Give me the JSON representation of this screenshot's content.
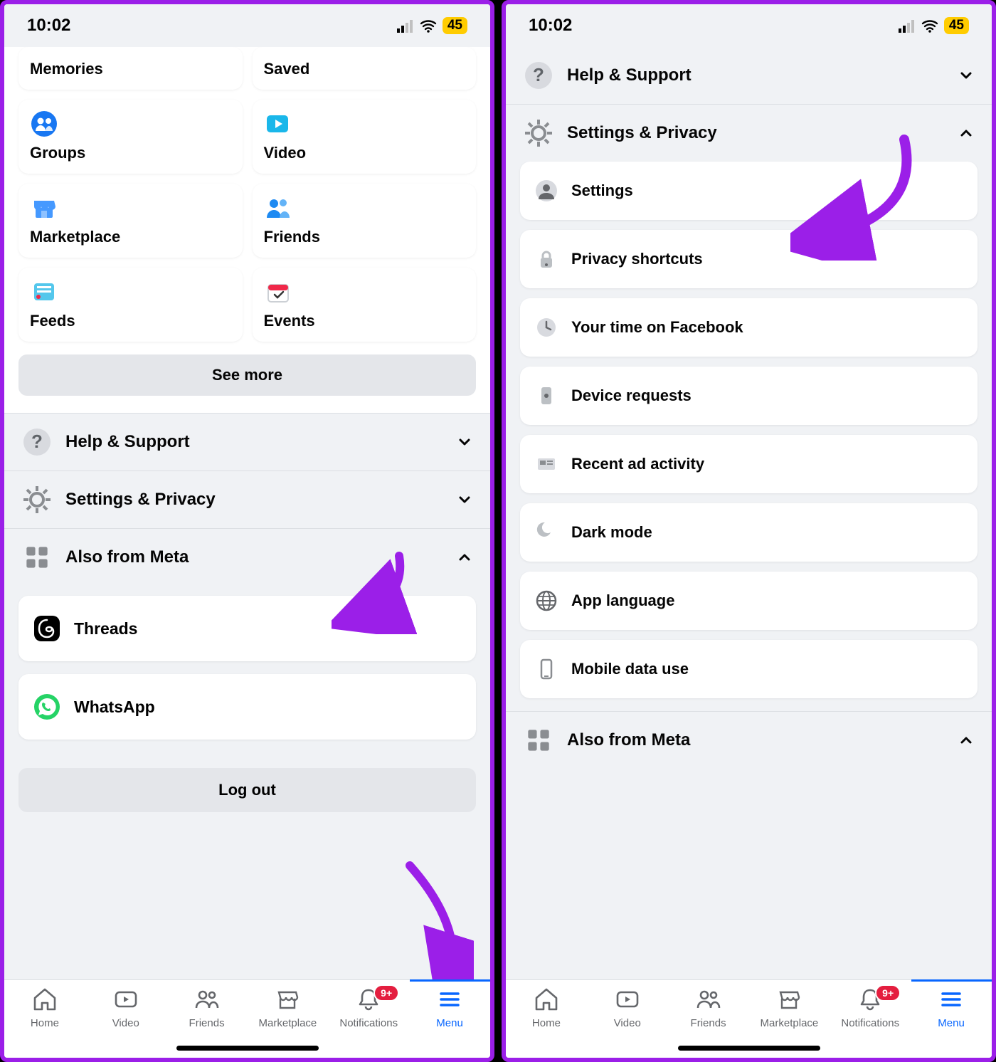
{
  "status": {
    "time": "10:02",
    "battery": "45"
  },
  "left": {
    "shortcuts": [
      {
        "id": "memories",
        "label": "Memories"
      },
      {
        "id": "saved",
        "label": "Saved"
      },
      {
        "id": "groups",
        "label": "Groups"
      },
      {
        "id": "video",
        "label": "Video"
      },
      {
        "id": "marketplace",
        "label": "Marketplace"
      },
      {
        "id": "friends",
        "label": "Friends"
      },
      {
        "id": "feeds",
        "label": "Feeds"
      },
      {
        "id": "events",
        "label": "Events"
      }
    ],
    "see_more": "See more",
    "sections": {
      "help": "Help & Support",
      "settings": "Settings & Privacy",
      "meta": "Also from Meta"
    },
    "meta_items": [
      {
        "id": "threads",
        "label": "Threads"
      },
      {
        "id": "whatsapp",
        "label": "WhatsApp"
      }
    ],
    "logout": "Log out"
  },
  "right": {
    "sections": {
      "help": "Help & Support",
      "settings": "Settings & Privacy",
      "meta": "Also from Meta"
    },
    "settings_items": [
      {
        "id": "settings",
        "label": "Settings"
      },
      {
        "id": "privacy-shortcuts",
        "label": "Privacy shortcuts"
      },
      {
        "id": "your-time",
        "label": "Your time on Facebook"
      },
      {
        "id": "device-requests",
        "label": "Device requests"
      },
      {
        "id": "recent-ad",
        "label": "Recent ad activity"
      },
      {
        "id": "dark-mode",
        "label": "Dark mode"
      },
      {
        "id": "app-language",
        "label": "App language"
      },
      {
        "id": "mobile-data",
        "label": "Mobile data use"
      }
    ]
  },
  "tabs": [
    {
      "id": "home",
      "label": "Home"
    },
    {
      "id": "video",
      "label": "Video"
    },
    {
      "id": "friends",
      "label": "Friends"
    },
    {
      "id": "marketplace",
      "label": "Marketplace"
    },
    {
      "id": "notifications",
      "label": "Notifications",
      "badge": "9+"
    },
    {
      "id": "menu",
      "label": "Menu",
      "active": true
    }
  ],
  "colors": {
    "accent": "#0866ff",
    "annotation": "#9b1fe8"
  }
}
